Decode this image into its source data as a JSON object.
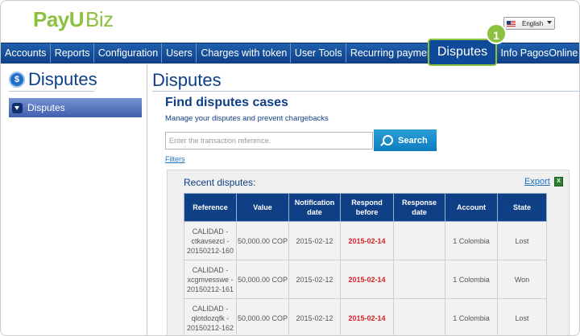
{
  "brand": {
    "logo_payu": "PayU",
    "logo_biz": "Biz"
  },
  "language": {
    "selected": "English"
  },
  "nav": {
    "items": [
      "Accounts",
      "Reports",
      "Configuration",
      "Users",
      "Charges with token",
      "User Tools",
      "Recurring payments"
    ],
    "highlighted": "Disputes",
    "after": "Info PagosOnline",
    "badge": "1"
  },
  "sidebar": {
    "title": "Disputes",
    "items": [
      "Disputes"
    ]
  },
  "main": {
    "title": "Disputes",
    "find_title": "Find disputes cases",
    "subtitle": "Manage your disputes and prevent chargebacks",
    "search_placeholder": "Enter the transaction reference.",
    "search_button": "Search",
    "filters": "Filters"
  },
  "recent": {
    "title": "Recent disputes:",
    "export": "Export",
    "columns": [
      "Reference",
      "Value",
      "Notification date",
      "Respond before",
      "Response date",
      "Account",
      "State"
    ],
    "rows": [
      {
        "reference": "CALIDAD - ctkavsezcl - 20150212-160",
        "value": "50,000.00 COP",
        "notification_date": "2015-02-12",
        "respond_before": "2015-02-14",
        "response_date": "",
        "account": "1 Colombia",
        "state": "Lost"
      },
      {
        "reference": "CALIDAD - xcgmvesswe - 20150212-161",
        "value": "50,000.00 COP",
        "notification_date": "2015-02-12",
        "respond_before": "2015-02-14",
        "response_date": "",
        "account": "1 Colombia",
        "state": "Won"
      },
      {
        "reference": "CALIDAD - qlotdozqfk - 20150212-162",
        "value": "50,000.00 COP",
        "notification_date": "2015-02-12",
        "respond_before": "2015-02-14",
        "response_date": "",
        "account": "1 Colombia",
        "state": "Lost"
      }
    ]
  },
  "colors": {
    "brand_green": "#8cc13f",
    "nav_blue": "#0e3f86",
    "alert_red": "#d8232a"
  }
}
